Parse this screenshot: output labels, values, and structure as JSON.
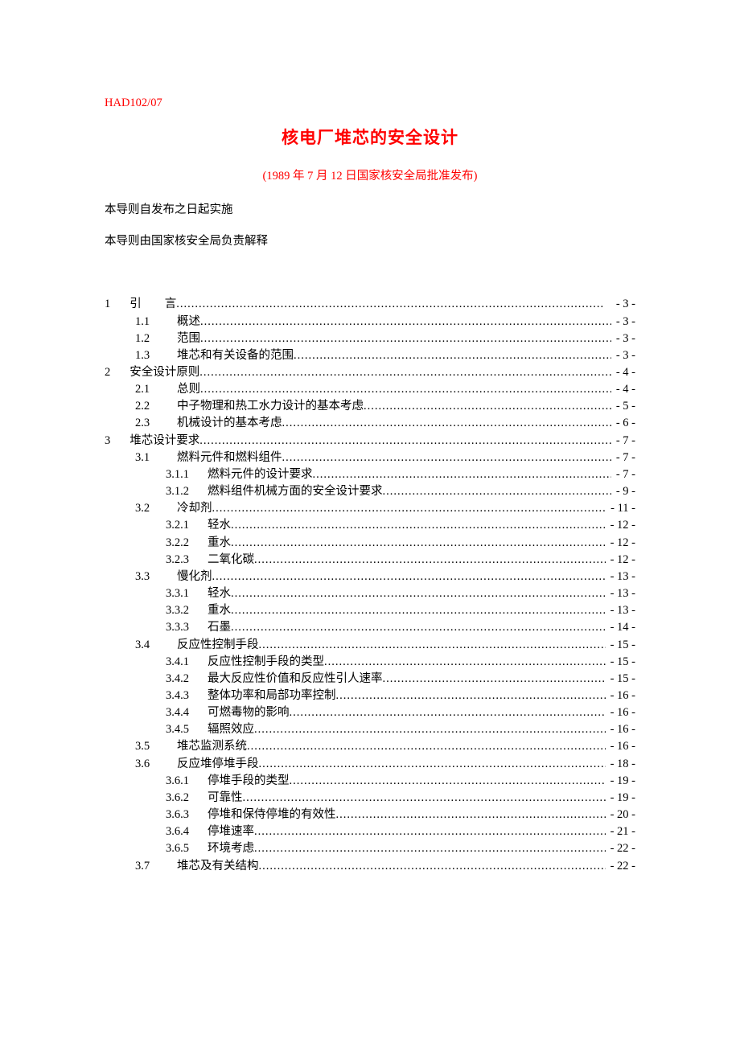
{
  "doc_code": "HAD102/07",
  "doc_title": "核电厂堆芯的安全设计",
  "doc_subtitle": "(1989 年 7 月 12 日国家核安全局批准发布)",
  "doc_note1": "本导则自发布之日起实施",
  "doc_note2": "本导则由国家核安全局负责解释",
  "toc": [
    {
      "indent": 0,
      "num": "1",
      "label": "引　　言",
      "page": "- 3 -"
    },
    {
      "indent": 1,
      "num": "1.1",
      "label": "概述",
      "page": "- 3 -"
    },
    {
      "indent": 1,
      "num": "1.2",
      "label": "范围",
      "page": "- 3 -"
    },
    {
      "indent": 1,
      "num": "1.3",
      "label": "堆芯和有关设备的范围",
      "page": "- 3 -"
    },
    {
      "indent": 0,
      "num": "2",
      "label": "安全设计原则",
      "page": "- 4 -"
    },
    {
      "indent": 1,
      "num": "2.1",
      "label": "总则",
      "page": "- 4 -"
    },
    {
      "indent": 1,
      "num": "2.2",
      "label": "中子物理和热工水力设计的基本考虑",
      "page": "- 5 -"
    },
    {
      "indent": 1,
      "num": "2.3",
      "label": "机械设计的基本考虑",
      "page": "- 6 -"
    },
    {
      "indent": 0,
      "num": "3",
      "label": "堆芯设计要求",
      "page": "- 7 -"
    },
    {
      "indent": 1,
      "num": "3.1",
      "label": "燃料元件和燃料组件",
      "page": "- 7 -"
    },
    {
      "indent": 2,
      "num": "3.1.1",
      "label": "燃料元件的设计要求",
      "page": "- 7 -"
    },
    {
      "indent": 2,
      "num": "3.1.2",
      "label": "燃料组件机械方面的安全设计要求",
      "page": "- 9 -"
    },
    {
      "indent": 1,
      "num": "3.2",
      "label": "冷却剂",
      "page": "- 11 -"
    },
    {
      "indent": 2,
      "num": "3.2.1",
      "label": "轻水",
      "page": "- 12 -"
    },
    {
      "indent": 2,
      "num": "3.2.2",
      "label": "重水",
      "page": "- 12 -"
    },
    {
      "indent": 2,
      "num": "3.2.3",
      "label": "二氧化碳",
      "page": "- 12 -"
    },
    {
      "indent": 1,
      "num": "3.3",
      "label": "慢化剂",
      "page": "- 13 -"
    },
    {
      "indent": 2,
      "num": "3.3.1",
      "label": "轻水",
      "page": "- 13 -"
    },
    {
      "indent": 2,
      "num": "3.3.2",
      "label": "重水",
      "page": "- 13 -"
    },
    {
      "indent": 2,
      "num": "3.3.3",
      "label": "石墨",
      "page": "- 14 -"
    },
    {
      "indent": 1,
      "num": "3.4",
      "label": "反应性控制手段",
      "page": "- 15 -"
    },
    {
      "indent": 2,
      "num": "3.4.1",
      "label": "反应性控制手段的类型",
      "page": "- 15 -"
    },
    {
      "indent": 2,
      "num": "3.4.2",
      "label": "最大反应性价值和反应性引人速率",
      "page": "- 15 -"
    },
    {
      "indent": 2,
      "num": "3.4.3",
      "label": "整体功率和局部功率控制",
      "page": "- 16 -"
    },
    {
      "indent": 2,
      "num": "3.4.4",
      "label": "可燃毒物的影响",
      "page": "- 16 -"
    },
    {
      "indent": 2,
      "num": "3.4.5",
      "label": "辐照效应",
      "page": "- 16 -"
    },
    {
      "indent": 1,
      "num": "3.5",
      "label": "堆芯监测系统",
      "page": "- 16 -"
    },
    {
      "indent": 1,
      "num": "3.6",
      "label": "反应堆停堆手段",
      "page": "- 18 -"
    },
    {
      "indent": 2,
      "num": "3.6.1",
      "label": "停堆手段的类型",
      "page": "- 19 -"
    },
    {
      "indent": 2,
      "num": "3.6.2",
      "label": "可靠性",
      "page": "- 19 -"
    },
    {
      "indent": 2,
      "num": "3.6.3",
      "label": "停堆和保侍停堆的有效性",
      "page": "- 20 -"
    },
    {
      "indent": 2,
      "num": "3.6.4",
      "label": "停堆速率",
      "page": "- 21 -"
    },
    {
      "indent": 2,
      "num": "3.6.5",
      "label": "环境考虑",
      "page": "- 22 -"
    },
    {
      "indent": 1,
      "num": "3.7",
      "label": "堆芯及有关结构",
      "page": "- 22 -"
    }
  ]
}
